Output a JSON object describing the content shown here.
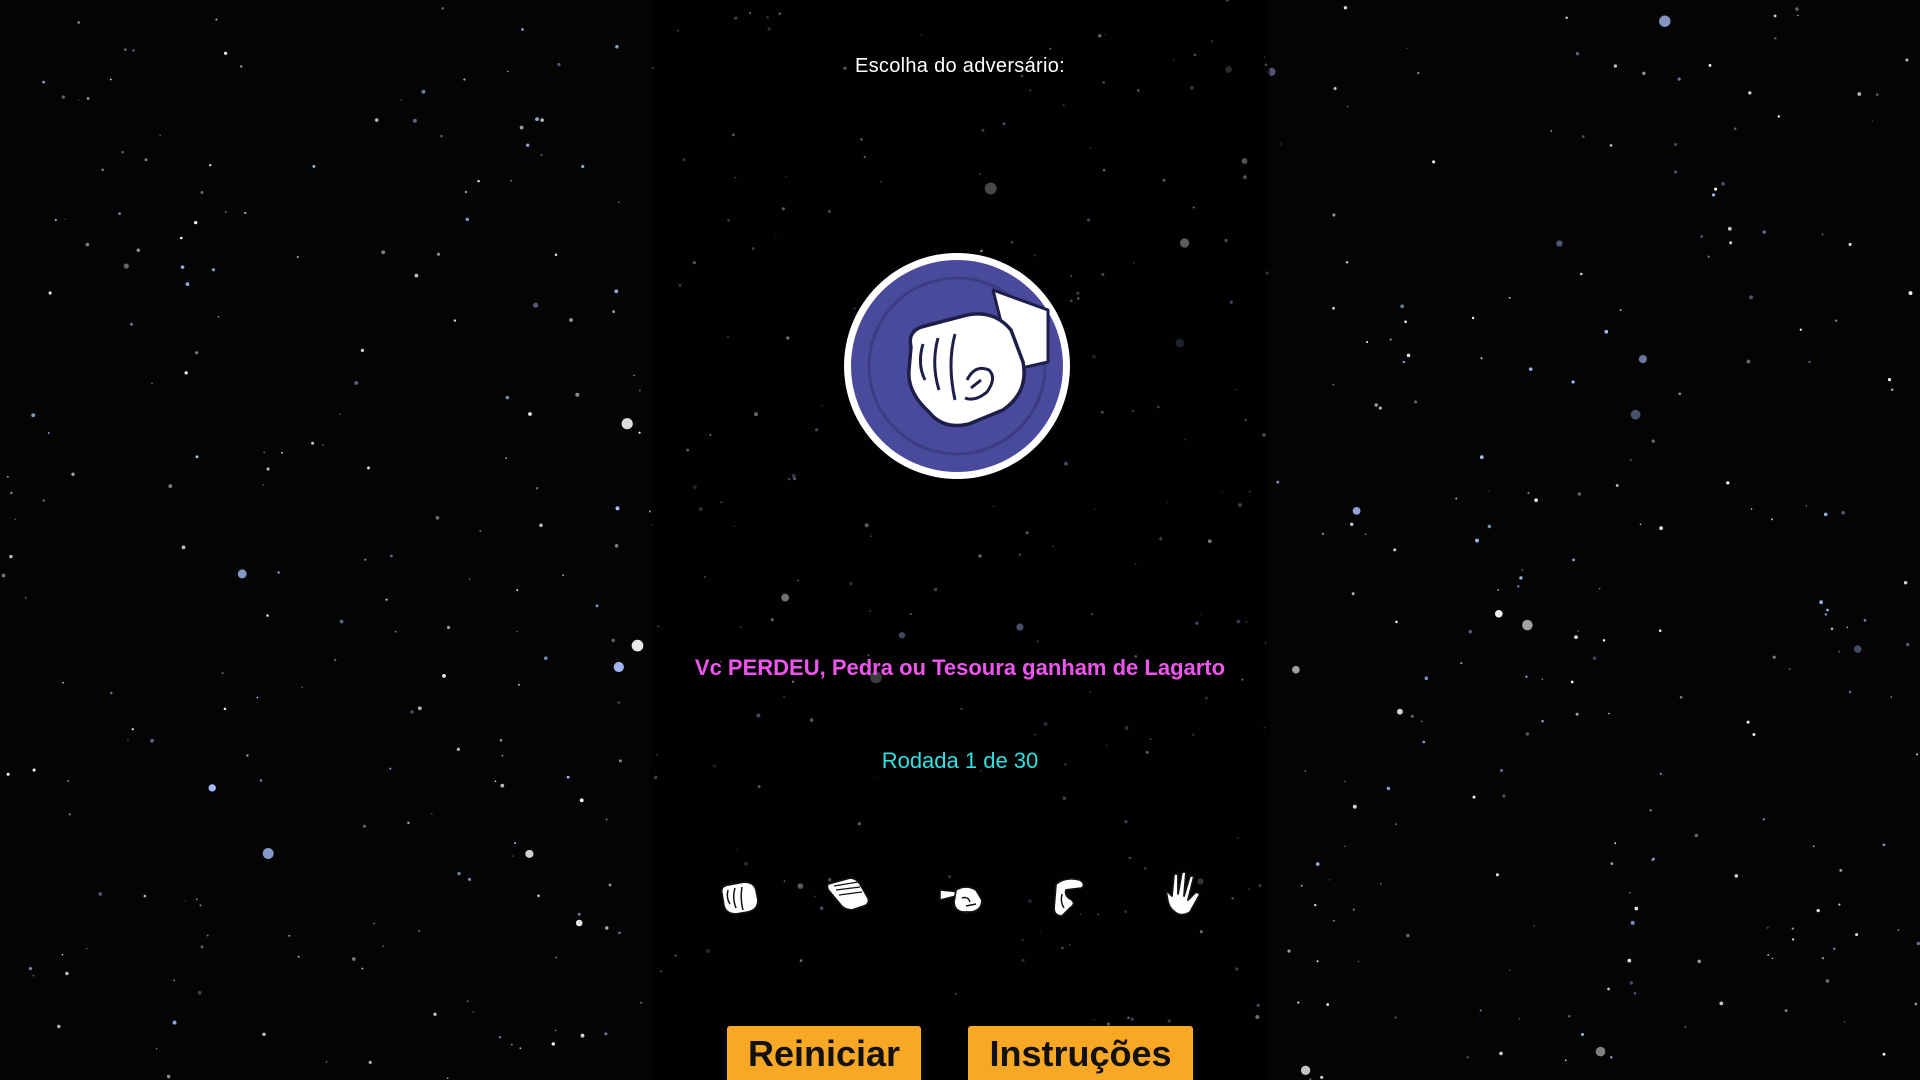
{
  "game": {
    "opponent_label": "Escolha do adversário:",
    "opponent_choice_icon": "rock-hand-icon",
    "result_message": "Vc PERDEU, Pedra ou Tesoura ganham de Lagarto",
    "round_text": "Rodada 1 de 30"
  },
  "hands": [
    {
      "name": "rock-hand-icon"
    },
    {
      "name": "paper-hand-icon"
    },
    {
      "name": "scissors-hand-icon"
    },
    {
      "name": "lizard-hand-icon"
    },
    {
      "name": "spock-hand-icon"
    }
  ],
  "buttons": {
    "restart_label": "Reiniciar",
    "instructions_label": "Instruções"
  },
  "colors": {
    "result": "#ee55ee",
    "round": "#33e0e0",
    "button_bg": "#f9a825",
    "badge_bg": "#4a4a9c"
  }
}
